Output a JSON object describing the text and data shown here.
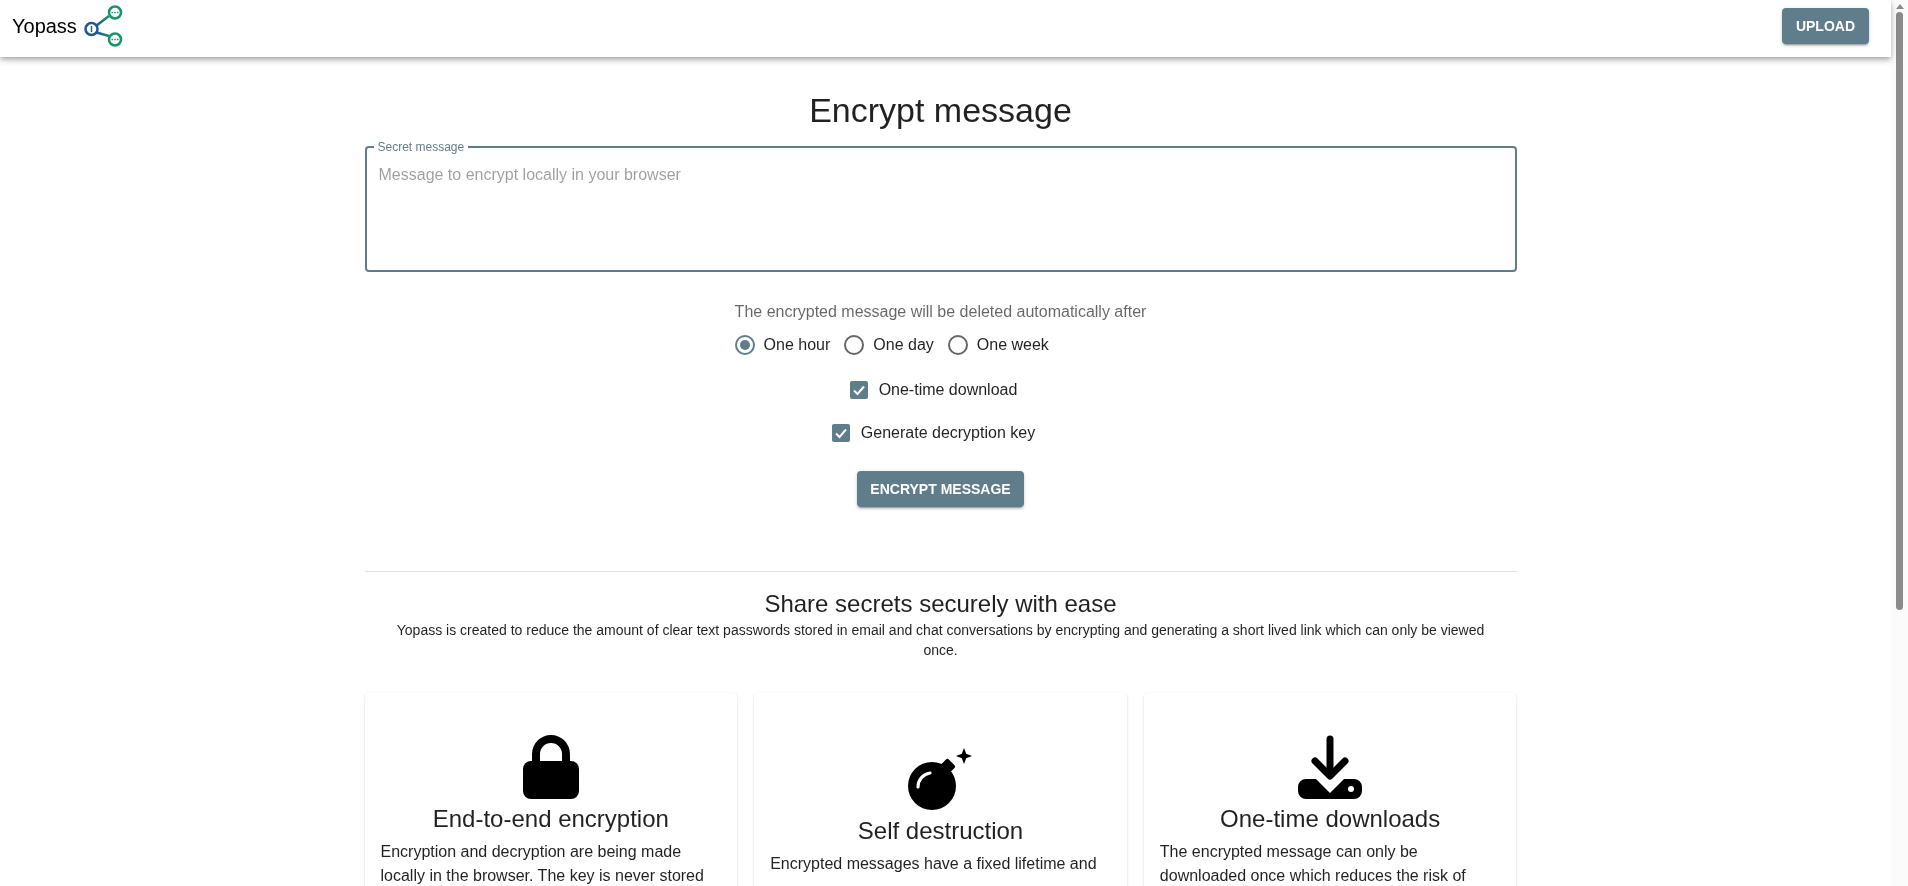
{
  "header": {
    "brand": "Yopass",
    "upload_button": "UPLOAD"
  },
  "encrypt_form": {
    "title": "Encrypt message",
    "secret_field": {
      "label": "Secret message",
      "placeholder": "Message to encrypt locally in your browser"
    },
    "expiration": {
      "hint": "The encrypted message will be deleted automatically after",
      "options": [
        {
          "label": "One hour",
          "selected": true
        },
        {
          "label": "One day",
          "selected": false
        },
        {
          "label": "One week",
          "selected": false
        }
      ]
    },
    "options": [
      {
        "label": "One-time download",
        "checked": true
      },
      {
        "label": "Generate decryption key",
        "checked": true
      }
    ],
    "submit_button": "ENCRYPT MESSAGE"
  },
  "features": {
    "title": "Share secrets securely with ease",
    "description": "Yopass is created to reduce the amount of clear text passwords stored in email and chat conversations by encrypting and generating a short lived link which can only be viewed once.",
    "cards": [
      {
        "title": "End-to-end encryption",
        "text": "Encryption and decryption are being made locally in the browser. The key is never stored"
      },
      {
        "title": "Self destruction",
        "text": "Encrypted messages have a fixed lifetime and"
      },
      {
        "title": "One-time downloads",
        "text": "The encrypted message can only be downloaded once which reduces the risk of"
      }
    ]
  }
}
